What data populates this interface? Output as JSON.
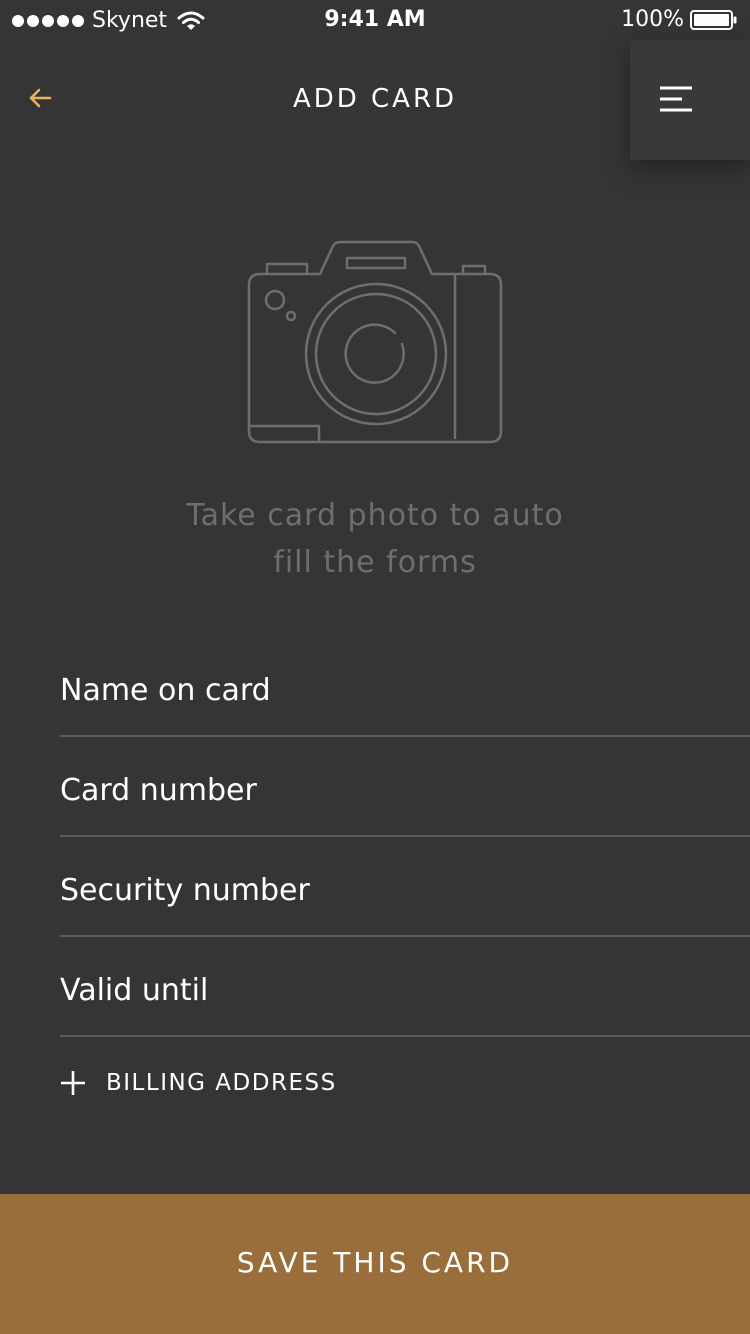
{
  "status_bar": {
    "carrier": "Skynet",
    "time": "9:41 AM",
    "battery": "100%"
  },
  "header": {
    "title": "ADD CARD",
    "back_icon": "arrow-left-icon",
    "menu_icon": "menu-icon"
  },
  "camera": {
    "icon": "camera-icon",
    "hint_line1": "Take card photo to auto",
    "hint_line2": "fill the forms"
  },
  "form": {
    "fields": [
      {
        "placeholder": "Name on card",
        "value": ""
      },
      {
        "placeholder": "Card number",
        "value": ""
      },
      {
        "placeholder": "Security number",
        "value": ""
      },
      {
        "placeholder": "Valid until",
        "value": ""
      }
    ],
    "billing_label": "BILLING ADDRESS"
  },
  "footer": {
    "save_label": "SAVE THIS CARD"
  },
  "colors": {
    "background": "#353535",
    "accent": "#9a6e3b",
    "back_arrow": "#e9b45c",
    "hint_text": "#6e6e6e",
    "divider": "#5a5a5a"
  }
}
